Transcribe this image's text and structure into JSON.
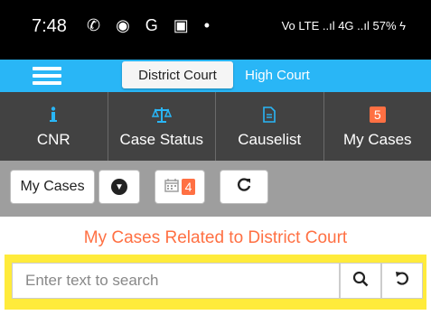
{
  "status_bar": {
    "time": "7:48",
    "icons": "✆ ◉ G ▣ •",
    "right": "Vo LTE ..ıl 4G ..ıl 57% ϟ"
  },
  "app_bar": {
    "tab_district": "District Court",
    "tab_high": "High Court"
  },
  "nav": [
    {
      "label": "CNR",
      "icon": "info-icon"
    },
    {
      "label": "Case Status",
      "icon": "scale-icon"
    },
    {
      "label": "Causelist",
      "icon": "document-icon"
    },
    {
      "label": "My Cases",
      "icon": "badge",
      "badge": "5"
    }
  ],
  "toolbar": {
    "my_cases_label": "My Cases",
    "calendar_badge": "4"
  },
  "heading": "My Cases Related to District Court",
  "search": {
    "placeholder": "Enter text to search",
    "value": ""
  },
  "colors": {
    "app_bar": "#29b6f6",
    "nav": "#424242",
    "accent": "#ff7043",
    "highlight": "#ffeb3b"
  }
}
